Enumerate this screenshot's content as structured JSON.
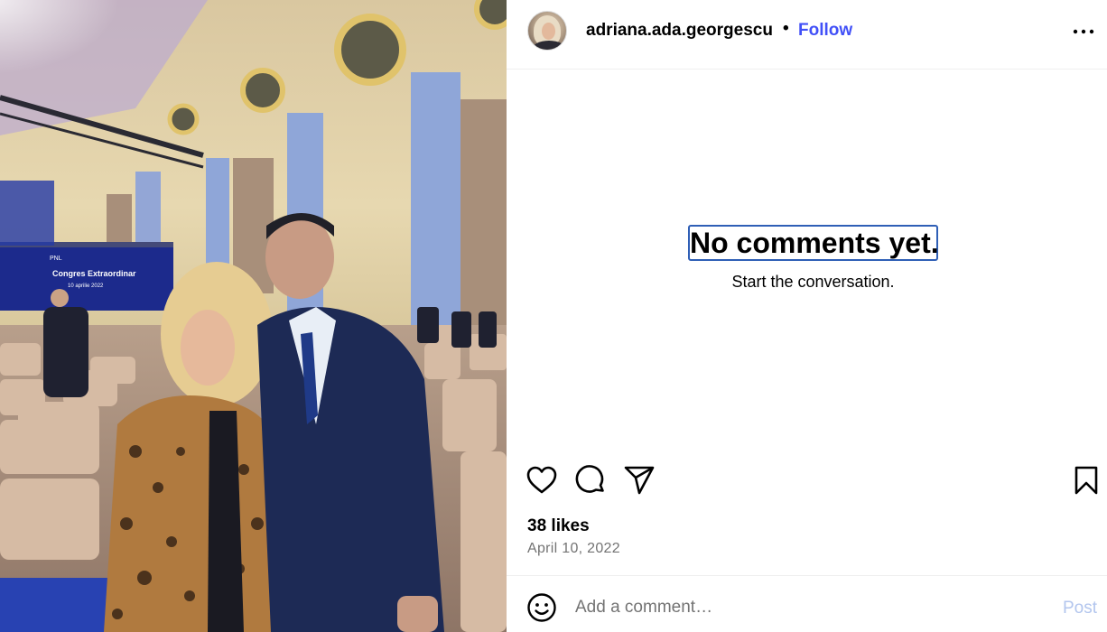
{
  "post": {
    "username": "adriana.ada.georgescu",
    "separator": "•",
    "follow_label": "Follow",
    "more_icon": "more-horizontal-icon",
    "avatar_alt": "profile picture"
  },
  "photo": {
    "screen_title": "Congres Extraordinar",
    "screen_date": "10 aprilie 2022",
    "screen_logo": "PNL"
  },
  "comments": {
    "empty_title": "No comments yet.",
    "empty_subtitle": "Start the conversation."
  },
  "actions": {
    "like_icon": "heart-icon",
    "comment_icon": "comment-bubble-icon",
    "share_icon": "paper-plane-icon",
    "save_icon": "bookmark-icon"
  },
  "stats": {
    "likes": "38 likes",
    "date": "April 10, 2022"
  },
  "comment_box": {
    "placeholder": "Add a comment…",
    "post_label": "Post",
    "emoji_icon": "smiley-icon"
  },
  "colors": {
    "follow": "#4150f7",
    "post_disabled": "#b3c6ee",
    "muted_text": "#737373",
    "focus_outline": "#2f5fb6"
  }
}
